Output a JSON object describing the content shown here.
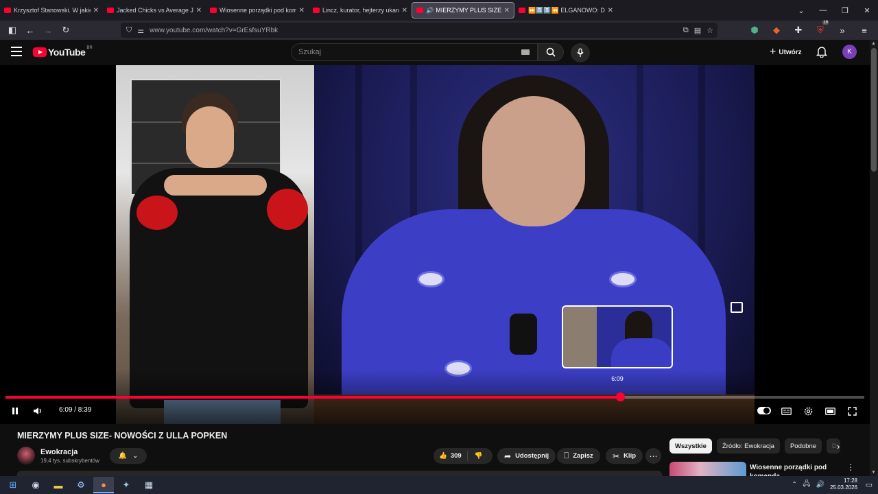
{
  "browser": {
    "tabs": [
      {
        "label": "Krzysztof Stanowski. W jakiej sp"
      },
      {
        "label": "Jacked Chicks vs Average Joes |"
      },
      {
        "label": "Wiosenne porządki pod komen"
      },
      {
        "label": "Lincz, kurator, hejterzy ukarani?"
      },
      {
        "label": "MIERZYMY PLUS SIZE- NOW"
      },
      {
        "label": "⏩5️⃣5️⃣⏪ ELGANOWO: D"
      }
    ],
    "url": "www.youtube.com/watch?v=GrEsfsuYRbk",
    "extension_badge": "19"
  },
  "youtube": {
    "logo_text": "YouTube",
    "region": "BR",
    "search_placeholder": "Szukaj",
    "create_label": "Utwórz",
    "avatar_letter": "K"
  },
  "player": {
    "progress": 0.716,
    "current_time": "6:09",
    "duration": "8:39",
    "time_display": "6:09 / 8:39",
    "preview_time": "6:09"
  },
  "video": {
    "title": "MIERZYMY PLUS SIZE- NOWOŚCI Z ULLA POPKEN",
    "channel": "Ewokracja",
    "subscribers": "19,4 tys. subskrybentów",
    "likes": "309",
    "share_label": "Udostępnij",
    "save_label": "Zapisz",
    "clip_label": "Klip"
  },
  "sidebar": {
    "chips": [
      "Wszystkie",
      "Źródło: Ewokracja",
      "Podobne",
      "D"
    ],
    "recommendation_title": "Wiosenne porządki pod komenda"
  },
  "taskbar": {
    "time": "17:28",
    "date": "25.03.2026"
  }
}
